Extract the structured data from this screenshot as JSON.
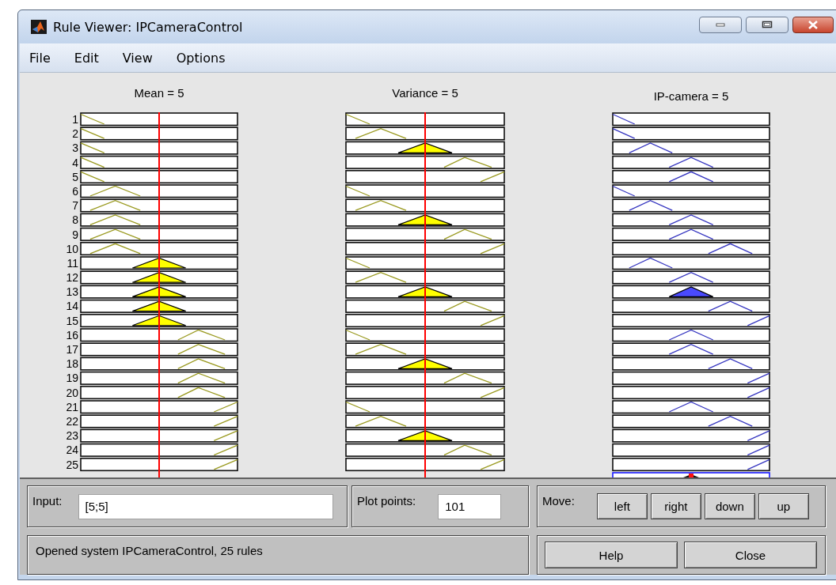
{
  "window": {
    "title": "Rule Viewer: IPCameraControl"
  },
  "menu": [
    "File",
    "Edit",
    "View",
    "Options"
  ],
  "columns": [
    {
      "header": "Mean = 5",
      "kind": "input",
      "level": 0.5
    },
    {
      "header": "Variance = 5",
      "kind": "input",
      "level": 0.5
    },
    {
      "header": "IP-camera = 5",
      "kind": "output"
    }
  ],
  "rules": [
    {
      "number": "1",
      "cells": [
        {
          "kind": "left",
          "fired": false
        },
        {
          "kind": "left",
          "fired": false
        },
        {
          "kind": "left",
          "fired": false
        }
      ]
    },
    {
      "number": "2",
      "cells": [
        {
          "kind": "left",
          "fired": false
        },
        {
          "kind": "low",
          "fired": false
        },
        {
          "kind": "left",
          "fired": false
        }
      ]
    },
    {
      "number": "3",
      "cells": [
        {
          "kind": "left",
          "fired": false
        },
        {
          "kind": "mid",
          "fired": true
        },
        {
          "kind": "low",
          "fired": false
        }
      ]
    },
    {
      "number": "4",
      "cells": [
        {
          "kind": "left",
          "fired": false
        },
        {
          "kind": "high",
          "fired": false
        },
        {
          "kind": "mid",
          "fired": false
        }
      ]
    },
    {
      "number": "5",
      "cells": [
        {
          "kind": "left",
          "fired": false
        },
        {
          "kind": "right",
          "fired": false
        },
        {
          "kind": "mid",
          "fired": false
        }
      ]
    },
    {
      "number": "6",
      "cells": [
        {
          "kind": "low",
          "fired": false
        },
        {
          "kind": "left",
          "fired": false
        },
        {
          "kind": "left",
          "fired": false
        }
      ]
    },
    {
      "number": "7",
      "cells": [
        {
          "kind": "low",
          "fired": false
        },
        {
          "kind": "low",
          "fired": false
        },
        {
          "kind": "low",
          "fired": false
        }
      ]
    },
    {
      "number": "8",
      "cells": [
        {
          "kind": "low",
          "fired": false
        },
        {
          "kind": "mid",
          "fired": true
        },
        {
          "kind": "mid",
          "fired": false
        }
      ]
    },
    {
      "number": "9",
      "cells": [
        {
          "kind": "low",
          "fired": false
        },
        {
          "kind": "high",
          "fired": false
        },
        {
          "kind": "mid",
          "fired": false
        }
      ]
    },
    {
      "number": "10",
      "cells": [
        {
          "kind": "low",
          "fired": false
        },
        {
          "kind": "right",
          "fired": false
        },
        {
          "kind": "high",
          "fired": false
        }
      ]
    },
    {
      "number": "11",
      "cells": [
        {
          "kind": "mid",
          "fired": true
        },
        {
          "kind": "left",
          "fired": false
        },
        {
          "kind": "low",
          "fired": false
        }
      ]
    },
    {
      "number": "12",
      "cells": [
        {
          "kind": "mid",
          "fired": true
        },
        {
          "kind": "low",
          "fired": false
        },
        {
          "kind": "mid",
          "fired": false
        }
      ]
    },
    {
      "number": "13",
      "cells": [
        {
          "kind": "mid",
          "fired": true
        },
        {
          "kind": "mid",
          "fired": true
        },
        {
          "kind": "mid",
          "fired": true
        }
      ]
    },
    {
      "number": "14",
      "cells": [
        {
          "kind": "mid",
          "fired": true
        },
        {
          "kind": "high",
          "fired": false
        },
        {
          "kind": "high",
          "fired": false
        }
      ]
    },
    {
      "number": "15",
      "cells": [
        {
          "kind": "mid",
          "fired": true
        },
        {
          "kind": "right",
          "fired": false
        },
        {
          "kind": "right",
          "fired": false
        }
      ]
    },
    {
      "number": "16",
      "cells": [
        {
          "kind": "high",
          "fired": false
        },
        {
          "kind": "left",
          "fired": false
        },
        {
          "kind": "mid",
          "fired": false
        }
      ]
    },
    {
      "number": "17",
      "cells": [
        {
          "kind": "high",
          "fired": false
        },
        {
          "kind": "low",
          "fired": false
        },
        {
          "kind": "mid",
          "fired": false
        }
      ]
    },
    {
      "number": "18",
      "cells": [
        {
          "kind": "high",
          "fired": false
        },
        {
          "kind": "mid",
          "fired": true
        },
        {
          "kind": "high",
          "fired": false
        }
      ]
    },
    {
      "number": "19",
      "cells": [
        {
          "kind": "high",
          "fired": false
        },
        {
          "kind": "high",
          "fired": false
        },
        {
          "kind": "right",
          "fired": false
        }
      ]
    },
    {
      "number": "20",
      "cells": [
        {
          "kind": "high",
          "fired": false
        },
        {
          "kind": "right",
          "fired": false
        },
        {
          "kind": "right",
          "fired": false
        }
      ]
    },
    {
      "number": "21",
      "cells": [
        {
          "kind": "right",
          "fired": false
        },
        {
          "kind": "left",
          "fired": false
        },
        {
          "kind": "mid",
          "fired": false
        }
      ]
    },
    {
      "number": "22",
      "cells": [
        {
          "kind": "right",
          "fired": false
        },
        {
          "kind": "low",
          "fired": false
        },
        {
          "kind": "high",
          "fired": false
        }
      ]
    },
    {
      "number": "23",
      "cells": [
        {
          "kind": "right",
          "fired": false
        },
        {
          "kind": "mid",
          "fired": true
        },
        {
          "kind": "right",
          "fired": false
        }
      ]
    },
    {
      "number": "24",
      "cells": [
        {
          "kind": "right",
          "fired": false
        },
        {
          "kind": "high",
          "fired": false
        },
        {
          "kind": "right",
          "fired": false
        }
      ]
    },
    {
      "number": "25",
      "cells": [
        {
          "kind": "right",
          "fired": false
        },
        {
          "kind": "right",
          "fired": false
        },
        {
          "kind": "right",
          "fired": false
        }
      ]
    }
  ],
  "input": {
    "label": "Input:",
    "value": "[5;5]"
  },
  "plot_points": {
    "label": "Plot points:",
    "value": "101"
  },
  "move": {
    "label": "Move:",
    "buttons": [
      "left",
      "right",
      "down",
      "up"
    ]
  },
  "status": "Opened system IPCameraControl, 25 rules",
  "buttons": [
    "Help",
    "Close"
  ]
}
